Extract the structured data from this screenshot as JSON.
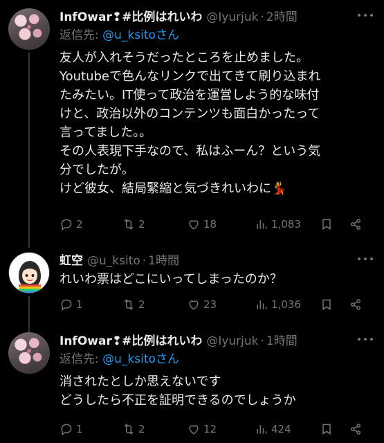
{
  "tweets": [
    {
      "name": "InfOwar❢#比例はれいわ",
      "handle": "@Iyurjuk",
      "dot": "·",
      "time": "2時間",
      "reply_prefix": "返信先: ",
      "reply_mention": "@u_ksitoさん",
      "lines": [
        "友人が入れそうだったところを止めました。",
        "Youtubeで色んなリンクで出てきて刷り込まれ",
        "たみたい。IT使って政治を運営しよう的な味付",
        "けと、政治以外のコンテンツも面白かったって",
        "言ってました。。",
        "その人表現下手なので、私はふーん？という気",
        "分でしたが。",
        "けど彼女、結局緊縮と気づきれいわに💃"
      ],
      "replies": "2",
      "retweets": "2",
      "likes": "18",
      "views": "1,083"
    },
    {
      "name": "虹空",
      "handle": "@u_ksito",
      "dot": "·",
      "time": "1時間",
      "lines": [
        "れいわ票はどこにいってしまったのか？"
      ],
      "replies": "1",
      "retweets": "2",
      "likes": "23",
      "views": "1,036"
    },
    {
      "name": "InfOwar❢#比例はれいわ",
      "handle": "@Iyurjuk",
      "dot": "·",
      "time": "1時間",
      "reply_prefix": "返信先: ",
      "reply_mention": "@u_ksitoさん",
      "lines": [
        "消されたとしか思えないです",
        "どうしたら不正を証明できるのでしょうか"
      ],
      "replies": "1",
      "retweets": "2",
      "likes": "12",
      "views": "424"
    }
  ],
  "icons": {
    "reply": "reply-icon",
    "retweet": "retweet-icon",
    "like": "heart-icon",
    "views": "views-icon",
    "bookmark": "bookmark-icon",
    "share": "share-icon",
    "more": "more-icon"
  },
  "colors": {
    "background": "#000000",
    "text": "#e7e9ea",
    "secondary": "#71767b",
    "link": "#1d9bf0"
  }
}
